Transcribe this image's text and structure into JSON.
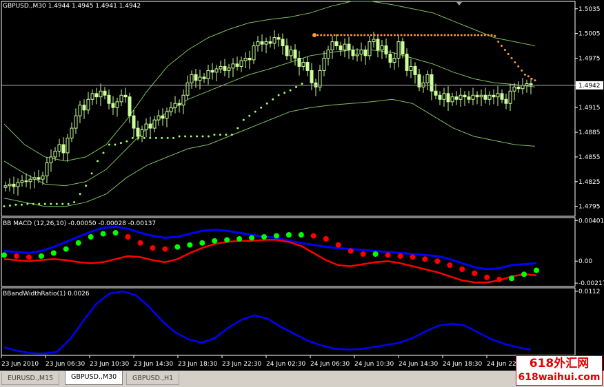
{
  "main_header": "GBPUSD.,M30  1.4944 1.4945 1.4941 1.4942",
  "macd_header": "BB MACD (12,26,10) -0.00050 -0.00028 -0.00137",
  "bw_header": "BBandWidthRatio(1) 0.0026",
  "tabs": [
    {
      "label": "EURUSD.,M15",
      "active": false
    },
    {
      "label": "GBPUSD.,M30",
      "active": true
    },
    {
      "label": "GBPUSD.,H1",
      "active": false
    }
  ],
  "watermark": {
    "line1": "618外汇网",
    "line2": "618waihui.com"
  },
  "colors": {
    "candle": "#ccff99",
    "bands": "#7fbf5f",
    "sar_bull": "#99ff66",
    "sar_bear": "#ff9933",
    "macd_up": "#00ff00",
    "macd_down": "#ff0000",
    "macd_upper": "#0000ff",
    "macd_lower": "#ff0000",
    "bw_line": "#0000ff",
    "price_line": "#b0b0b0"
  },
  "chart_data": [
    {
      "type": "candlestick",
      "symbol": "GBPUSD.",
      "timeframe": "M30",
      "current": {
        "open": 1.4944,
        "high": 1.4945,
        "low": 1.4941,
        "close": 1.4942
      },
      "ylim": [
        1.4783,
        1.5044
      ],
      "yticks": [
        "1.5035",
        "1.5005",
        "1.4975",
        "1.4942",
        "1.4915",
        "1.4885",
        "1.4855",
        "1.4825",
        "1.4795"
      ],
      "highlight_price": "1.4942",
      "xticks": [
        "23 Jun 2010",
        "23 Jun 06:30",
        "23 Jun 10:30",
        "23 Jun 14:30",
        "23 Jun 18:30",
        "23 Jun 22:30",
        "24 Jun 02:30",
        "24 Jun 06:30",
        "24 Jun 10:30",
        "24 Jun 14:30",
        "24 Jun 18:30",
        "24 Jun 22:"
      ],
      "close": [
        1.482,
        1.4822,
        1.4819,
        1.4824,
        1.4826,
        1.4825,
        1.4828,
        1.483,
        1.4828,
        1.4832,
        1.4848,
        1.4855,
        1.4862,
        1.487,
        1.486,
        1.4878,
        1.489,
        1.4905,
        1.4918,
        1.4912,
        1.4925,
        1.4932,
        1.4928,
        1.4935,
        1.493,
        1.492,
        1.4915,
        1.4922,
        1.493,
        1.4928,
        1.4905,
        1.489,
        1.488,
        1.4888,
        1.4895,
        1.489,
        1.49,
        1.4905,
        1.4902,
        1.491,
        1.4915,
        1.492,
        1.4918,
        1.493,
        1.4945,
        1.4955,
        1.4948,
        1.4952,
        1.495,
        1.496,
        1.4958,
        1.4962,
        1.4965,
        1.496,
        1.4963,
        1.4968,
        1.4965,
        1.4972,
        1.4975,
        1.4973,
        1.499,
        1.4995,
        1.4992,
        1.4995,
        1.4993,
        1.5,
        1.4998,
        1.499,
        1.4978,
        1.4985,
        1.4975,
        1.4965,
        1.497,
        1.496,
        1.4945,
        1.494,
        1.496,
        1.4975,
        1.4985,
        1.4995,
        1.499,
        1.4985,
        1.4992,
        1.4985,
        1.4978,
        1.498,
        1.4985,
        1.4978,
        1.4995,
        1.4998,
        1.4985,
        1.499,
        1.498,
        1.497,
        1.4975,
        1.4995,
        1.498,
        1.496,
        1.4965,
        1.4955,
        1.494,
        1.4945,
        1.4955,
        1.4935,
        1.493,
        1.4925,
        1.4932,
        1.4922,
        1.4928,
        1.4925,
        1.493,
        1.4928,
        1.4925,
        1.493,
        1.4928,
        1.493,
        1.4925,
        1.493,
        1.4928,
        1.4932,
        1.4925,
        1.492,
        1.4935,
        1.494,
        1.4938,
        1.4942,
        1.4944,
        1.4942
      ],
      "band_upper": [
        1.4895,
        1.487,
        1.4855,
        1.485,
        1.4855,
        1.487,
        1.49,
        1.4935,
        1.4965,
        1.4985,
        1.5,
        1.501,
        1.5018,
        1.5022,
        1.5025,
        1.503,
        1.5038,
        1.5044,
        1.5044,
        1.504,
        1.5035,
        1.503,
        1.502,
        1.501,
        1.5,
        1.4995,
        1.499
      ],
      "band_mid": [
        1.485,
        1.4835,
        1.4822,
        1.482,
        1.4825,
        1.484,
        1.4865,
        1.489,
        1.491,
        1.4925,
        1.4935,
        1.4945,
        1.4955,
        1.4962,
        1.497,
        1.4978,
        1.4982,
        1.4985,
        1.4985,
        1.4982,
        1.4975,
        1.4968,
        1.4958,
        1.495,
        1.4945,
        1.4943,
        1.494
      ],
      "band_lower": [
        1.4805,
        1.48,
        1.4795,
        1.4795,
        1.48,
        1.481,
        1.483,
        1.4845,
        1.4855,
        1.4865,
        1.487,
        1.488,
        1.489,
        1.49,
        1.491,
        1.4915,
        1.4918,
        1.492,
        1.4922,
        1.4925,
        1.492,
        1.4905,
        1.489,
        1.488,
        1.4875,
        1.487,
        1.4868
      ],
      "sar_bull": [
        1.4795,
        1.4796,
        1.4797,
        1.4797,
        1.4798,
        1.4798,
        1.4798,
        1.4798,
        1.4798,
        1.4798,
        1.4798,
        1.4798,
        1.48,
        1.481,
        1.482,
        1.4835,
        1.485,
        1.486,
        1.487,
        1.487,
        1.4872,
        1.4874,
        1.4878,
        1.4878,
        1.4878,
        1.4878,
        1.4878,
        1.4878,
        1.4878,
        1.4878,
        1.488,
        1.488,
        1.488,
        1.488,
        1.488,
        1.488,
        1.4882,
        1.4882,
        1.4882,
        1.4882,
        1.489,
        1.49,
        1.4905,
        1.491,
        1.4915,
        1.492,
        1.4925,
        1.493,
        1.4933,
        1.4936,
        1.494,
        1.4944
      ],
      "sar_bear": [
        1.5003,
        1.5003,
        1.5003,
        1.5003,
        1.5003,
        1.5003,
        1.5003,
        1.5003,
        1.5003,
        1.5003,
        1.5003,
        1.5003,
        1.5003,
        1.5003,
        1.5003,
        1.5003,
        1.5003,
        1.5003,
        1.5003,
        1.5003,
        1.5003,
        1.5003,
        1.5003,
        1.5003,
        1.5003,
        1.5003,
        1.5003,
        1.5003,
        1.5003,
        1.5003,
        1.5003,
        1.5003,
        1.5003,
        1.5003,
        1.5003,
        1.5003,
        1.5003,
        1.5003,
        1.5003,
        1.5003,
        1.5003,
        1.5003,
        1.5003,
        1.5003,
        1.5003,
        1.5003,
        1.5003,
        1.5003,
        1.5003,
        1.5003,
        1.5003,
        1.5003,
        1.5003,
        1.5003,
        1.5002,
        1.4995,
        1.499,
        1.4985,
        1.498,
        1.4975,
        1.497,
        1.4965,
        1.496,
        1.4955,
        1.4953,
        1.495,
        1.4948
      ]
    },
    {
      "type": "line",
      "name": "BB MACD (12,26,10)",
      "values": {
        "macd": -0.0005,
        "upper": -0.00028,
        "lower": -0.00137
      },
      "ylim": [
        -0.0025,
        0.0043
      ],
      "yticks": [
        "0.00401",
        "0.00",
        "-0.00217"
      ],
      "macd": [
        0.0006,
        0.0005,
        0.0004,
        0.0005,
        0.0008,
        0.0012,
        0.0018,
        0.0024,
        0.0027,
        0.0028,
        0.0024,
        0.0018,
        0.0013,
        0.0012,
        0.0014,
        0.0016,
        0.0018,
        0.002,
        0.0021,
        0.0022,
        0.0023,
        0.0024,
        0.0025,
        0.0026,
        0.0026,
        0.0025,
        0.0022,
        0.0016,
        0.001,
        0.0007,
        0.0007,
        0.0006,
        0.0005,
        0.0004,
        0.0002,
        0.0,
        -0.0004,
        -0.0008,
        -0.0012,
        -0.0016,
        -0.0018,
        -0.0017,
        -0.0013,
        -0.0009
      ],
      "upper": [
        0.001,
        0.0009,
        0.0008,
        0.001,
        0.0014,
        0.0019,
        0.0024,
        0.0029,
        0.0033,
        0.0034,
        0.0032,
        0.0028,
        0.0025,
        0.0023,
        0.0024,
        0.0027,
        0.003,
        0.0031,
        0.003,
        0.0028,
        0.0026,
        0.0024,
        0.0023,
        0.002,
        0.0018,
        0.0016,
        0.0014,
        0.0013,
        0.0012,
        0.0011,
        0.001,
        0.0009,
        0.0008,
        0.0007,
        0.0006,
        0.0005,
        0.0002,
        -0.0002,
        -0.0006,
        -0.0008,
        -0.0007,
        -0.0004,
        -0.0003,
        -0.0002
      ],
      "lower": [
        0.0002,
        0.0001,
        0.0,
        0.0001,
        0.0002,
        0.0001,
        -0.0001,
        -0.0002,
        -0.0001,
        0.0002,
        0.0005,
        0.0004,
        0.0001,
        -0.0001,
        0.0002,
        0.0008,
        0.0013,
        0.0017,
        0.0019,
        0.002,
        0.002,
        0.0021,
        0.0021,
        0.0019,
        0.0015,
        0.0008,
        0.0001,
        -0.0004,
        -0.0005,
        -0.0003,
        -0.0001,
        0.0,
        -0.0002,
        -0.0005,
        -0.0008,
        -0.0011,
        -0.0015,
        -0.0019,
        -0.0021,
        -0.0021,
        -0.0019,
        -0.0015,
        -0.0013,
        -0.0014
      ]
    },
    {
      "type": "line",
      "name": "BBandWidthRatio(1)",
      "value": 0.0026,
      "ylim": [
        0,
        0.0118
      ],
      "yticks": [
        "0.0112"
      ],
      "values": [
        0.0014,
        0.0008,
        0.0004,
        0.0003,
        0.0006,
        0.0028,
        0.006,
        0.009,
        0.0108,
        0.0112,
        0.0105,
        0.0085,
        0.006,
        0.004,
        0.0028,
        0.0022,
        0.003,
        0.0048,
        0.0062,
        0.007,
        0.0064,
        0.005,
        0.0038,
        0.0026,
        0.0018,
        0.0012,
        0.001,
        0.0011,
        0.0014,
        0.0018,
        0.0022,
        0.003,
        0.0042,
        0.0052,
        0.0055,
        0.0052,
        0.004,
        0.0028,
        0.002,
        0.0014,
        0.001
      ]
    }
  ]
}
